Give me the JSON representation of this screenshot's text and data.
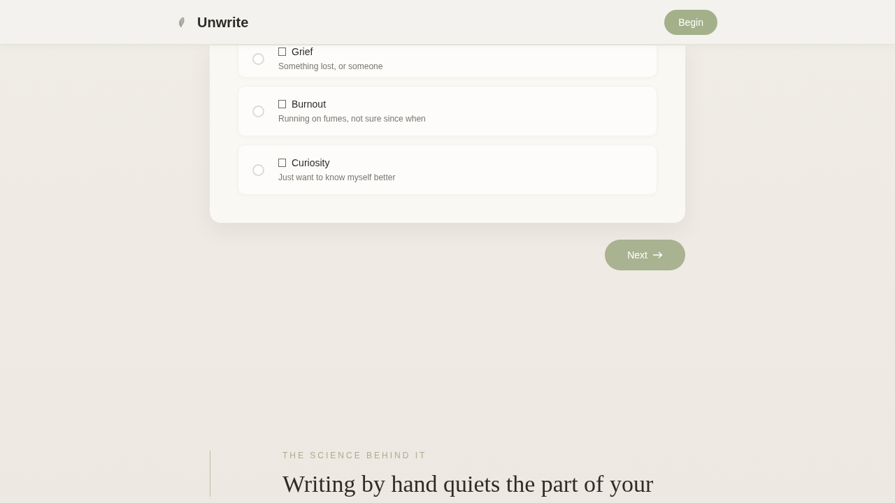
{
  "navbar": {
    "brand": "Unwrite",
    "begin_button": "Begin"
  },
  "options": [
    {
      "title": "Grief",
      "description": "Something lost, or someone",
      "selected": false
    },
    {
      "title": "Burnout",
      "description": "Running on fumes, not sure since when",
      "selected": false
    },
    {
      "title": "Curiosity",
      "description": "Just want to know myself better",
      "selected": false
    }
  ],
  "next_button": {
    "label": "Next",
    "disabled": true
  },
  "science": {
    "eyebrow": "THE SCIENCE BEHIND IT",
    "heading": "Writing by hand quiets the part of your"
  }
}
